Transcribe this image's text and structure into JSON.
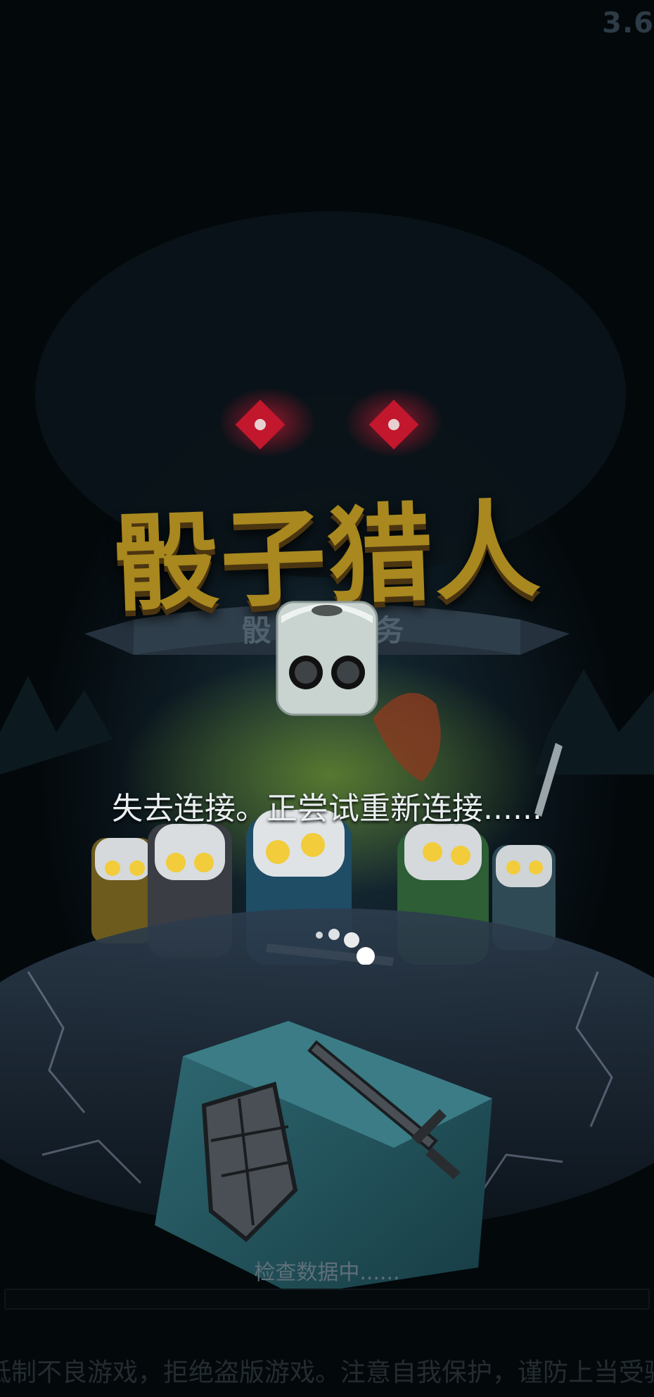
{
  "version": "3.6",
  "game": {
    "title": "骰子猎人",
    "banner_subtitle": "骰子 任务"
  },
  "status_message": "失去连接。正尝试重新连接......",
  "loader": {
    "text": "检查数据中......",
    "progress": 0
  },
  "notice": "抵制不良游戏，拒绝盗版游戏。注意自我保护，谨防上当受骗",
  "icons": [
    "dice-two-icon",
    "shield-icon",
    "sword-icon",
    "loading-dots-icon"
  ],
  "colors": {
    "background": "#020405",
    "title_gold": "#a8881f",
    "status_text": "#e9eef0",
    "demon_eye": "#c2172d"
  }
}
